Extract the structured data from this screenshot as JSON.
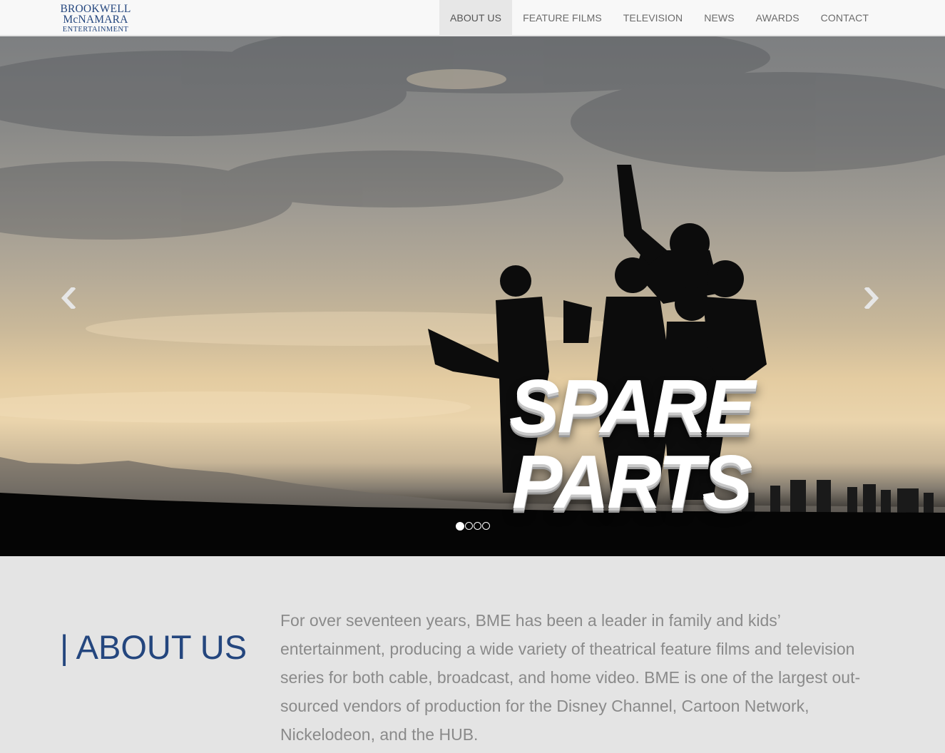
{
  "brand": {
    "line1": "BROOKWELL",
    "line2": "McNAMARA",
    "line3": "ENTERTAINMENT"
  },
  "nav": {
    "items": [
      {
        "label": "ABOUT US",
        "active": true
      },
      {
        "label": "FEATURE FILMS"
      },
      {
        "label": "TELEVISION"
      },
      {
        "label": "NEWS"
      },
      {
        "label": "AWARDS"
      },
      {
        "label": "CONTACT"
      }
    ]
  },
  "carousel": {
    "slide_title": "SPARE PARTS",
    "slide_count": 4,
    "active_index": 0,
    "prev_icon": "chevron-left-icon",
    "next_icon": "chevron-right-icon"
  },
  "about": {
    "heading": "| ABOUT US",
    "body": "For over seventeen years, BME has been a leader in family and kids’ entertainment, producing a wide variety of theatrical feature films and television series for both cable, broadcast, and home video. BME is one of the largest out-sourced vendors of production for the Disney Channel, Cartoon Network, Nickelodeon, and the HUB."
  },
  "colors": {
    "brand": "#24467e",
    "nav_text": "#6b6b6b",
    "nav_active_bg": "#e7e7e7",
    "section_bg": "#e4e4e4",
    "body_text": "#8a8a8a"
  }
}
